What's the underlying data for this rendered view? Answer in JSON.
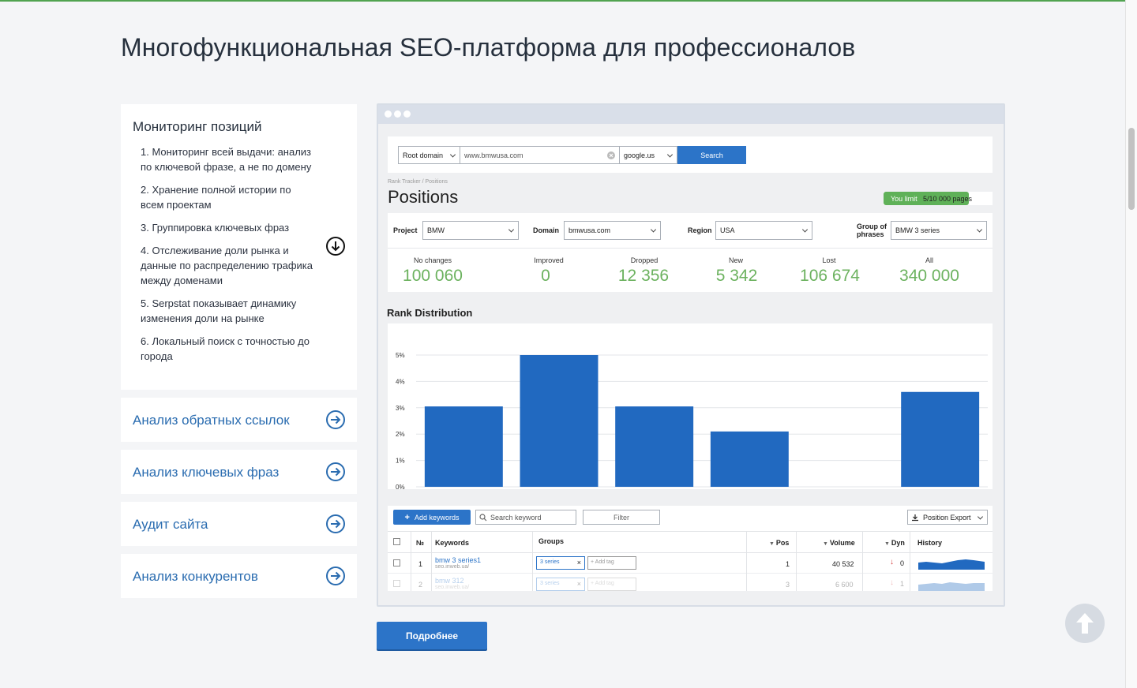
{
  "page": {
    "title": "Многофункциональная SEO-платформа для профессионалов",
    "more_button": "Подробнее"
  },
  "accordion": {
    "open": {
      "title": "Мониторинг позиций",
      "items": [
        "1. Мониторинг всей выдачи: анализ по ключевой фразе, а не по домену",
        "2. Хранение полной истории по всем проектам",
        "3. Группировка ключевых фраз",
        "4. Отслеживание доли рынка и данные по распределению трафика между доменами",
        "5. Serpstat показывает динамику изменения доли на рынке",
        "6. Локальный поиск с точностью до города"
      ]
    },
    "closed": [
      "Анализ обратных ссылок",
      "Анализ ключевых фраз",
      "Аудит сайта",
      "Анализ конкурентов"
    ]
  },
  "app": {
    "search": {
      "mode": "Root domain",
      "query": "www.bmwusa.com",
      "engine": "google.us",
      "button": "Search"
    },
    "breadcrumb": "Rank Tracker / Positions",
    "heading": "Positions",
    "limit": {
      "label": "You limit",
      "value": "5/10 000 pages"
    },
    "filters": {
      "project_label": "Project",
      "project": "BMW",
      "domain_label": "Domain",
      "domain": "bmwusa.com",
      "region_label": "Region",
      "region": "USA",
      "group_label_1": "Group of",
      "group_label_2": "phrases",
      "group": "BMW 3 series"
    },
    "stats": [
      {
        "label": "No changes",
        "value": "100 060"
      },
      {
        "label": "Improved",
        "value": "0"
      },
      {
        "label": "Dropped",
        "value": "12 356"
      },
      {
        "label": "New",
        "value": "5 342"
      },
      {
        "label": "Lost",
        "value": "106 674"
      },
      {
        "label": "All",
        "value": "340 000"
      }
    ],
    "toolbar": {
      "add": "Add keywords",
      "search_placeholder": "Search keyword",
      "filter": "Filter",
      "export": "Position Export"
    },
    "table": {
      "headers": {
        "num": "№",
        "keywords": "Keywords",
        "groups": "Groups",
        "pos": "Pos",
        "volume": "Volume",
        "dyn": "Dyn",
        "history": "History"
      },
      "add_tag": "Add tag",
      "rows": [
        {
          "num": "1",
          "keyword": "bmw 3 series1",
          "url": "seo.inweb.ua/",
          "tag": "3 series",
          "pos": "1",
          "volume": "40 532",
          "dyn": "0"
        },
        {
          "num": "2",
          "keyword": "bmw 312",
          "url": "seo.inweb.ua/",
          "tag": "3 series",
          "pos": "3",
          "volume": "6 600",
          "dyn": "1"
        }
      ]
    }
  },
  "chart_data": {
    "type": "bar",
    "title": "Rank Distribution",
    "categories": [
      "",
      "",
      "",
      "",
      "",
      ""
    ],
    "values": [
      3.05,
      5.0,
      3.05,
      2.1,
      0,
      3.6
    ],
    "yticks": [
      "0%",
      "1%",
      "2%",
      "3%",
      "4%",
      "5%"
    ],
    "ylim": [
      0,
      5
    ],
    "grid": true,
    "color": "#2169c0"
  }
}
